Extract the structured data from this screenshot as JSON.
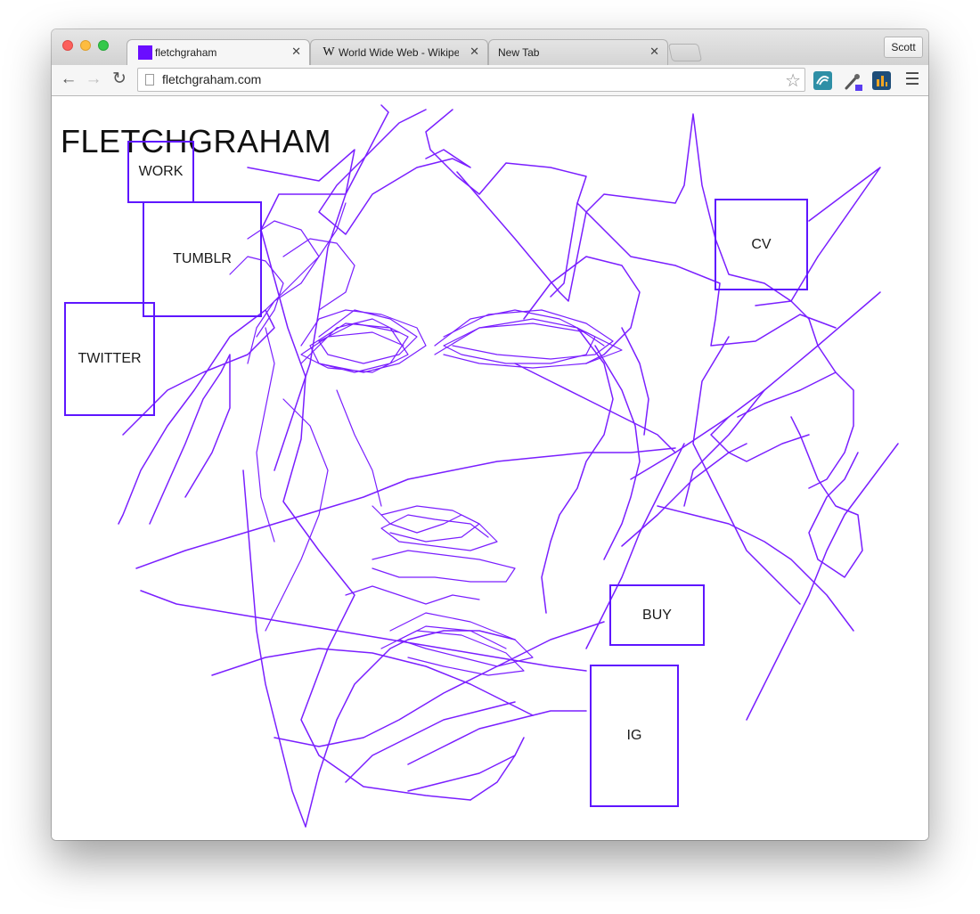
{
  "browser": {
    "tabs": [
      {
        "label": "fletchgraham",
        "favicon": "purple-square-favicon",
        "active": true
      },
      {
        "label": "World Wide Web - Wikipedia",
        "favicon": "wikipedia-w-favicon",
        "active": false
      },
      {
        "label": "New Tab",
        "favicon": "",
        "active": false
      }
    ],
    "profile_label": "Scott",
    "url": "fletchgraham.com"
  },
  "site": {
    "title": "FLETCHGRAHAM",
    "nav": {
      "work": "WORK",
      "tumblr": "TUMBLR",
      "twitter": "TWITTER",
      "cv": "CV",
      "buy": "BUY",
      "ig": "IG"
    }
  },
  "colors": {
    "accent": "#6a0dff",
    "scribble": "#7a1fff",
    "box_border": "#5e16ff"
  },
  "icons": [
    "back-icon",
    "forward-icon",
    "reload-icon",
    "page-icon",
    "star-icon",
    "extension-icon",
    "eyedropper-icon",
    "stats-icon",
    "menu-icon"
  ]
}
